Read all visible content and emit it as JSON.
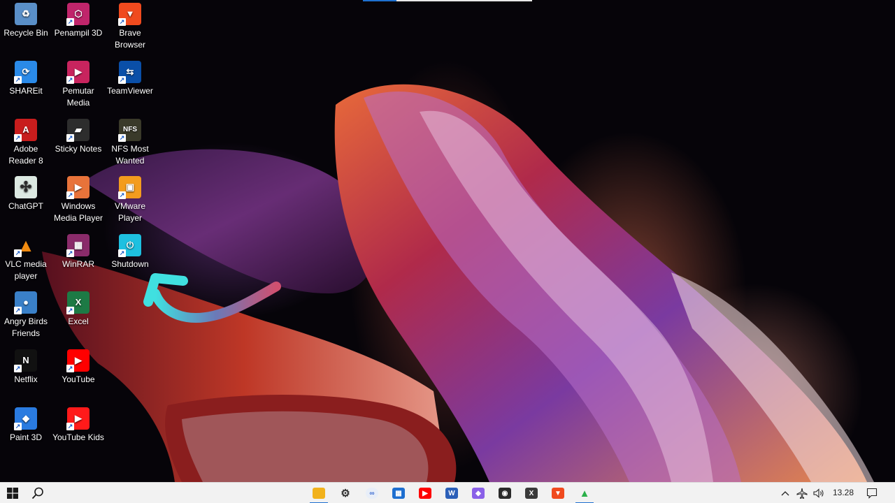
{
  "desktop": {
    "icons": [
      {
        "label": "Recycle Bin",
        "icon": "recycle-bin-icon",
        "color": "#5a8fc8",
        "glyph": "♻",
        "shortcut": false
      },
      {
        "label": "Penampil 3D",
        "icon": "3d-viewer-icon",
        "color": "#c0256b",
        "glyph": "⬡",
        "shortcut": true
      },
      {
        "label": "Brave Browser",
        "icon": "brave-icon",
        "color": "#f04a1e",
        "glyph": "▼",
        "shortcut": true
      },
      {
        "label": "SHAREit",
        "icon": "shareit-icon",
        "color": "#2a8ae8",
        "glyph": "⟳",
        "shortcut": true
      },
      {
        "label": "Pemutar Media",
        "icon": "media-player-icon",
        "color": "#c8245e",
        "glyph": "▶",
        "shortcut": true
      },
      {
        "label": "TeamViewer",
        "icon": "teamviewer-icon",
        "color": "#0a4fa8",
        "glyph": "⇆",
        "shortcut": true
      },
      {
        "label": "Adobe Reader 8",
        "icon": "adobe-reader-icon",
        "color": "#c81d1d",
        "glyph": "A",
        "shortcut": true
      },
      {
        "label": "Sticky Notes",
        "icon": "sticky-notes-icon",
        "color": "#2d2d2d",
        "glyph": "▰",
        "shortcut": true
      },
      {
        "label": "NFS Most Wanted",
        "icon": "nfs-icon",
        "color": "#3a3a2a",
        "glyph": "NFS",
        "shortcut": true
      },
      {
        "label": "ChatGPT",
        "icon": "chatgpt-icon",
        "color": "#dce9e2",
        "glyph": "✣",
        "shortcut": false
      },
      {
        "label": "Windows Media Player",
        "icon": "windows-media-player-icon",
        "color": "#e8733a",
        "glyph": "▶",
        "shortcut": true
      },
      {
        "label": "VMware Player",
        "icon": "vmware-icon",
        "color": "#f39c1e",
        "glyph": "▣",
        "shortcut": true
      },
      {
        "label": "VLC media player",
        "icon": "vlc-icon",
        "color": "transparent",
        "glyph": "▲",
        "shortcut": true
      },
      {
        "label": "WinRAR",
        "icon": "winrar-icon",
        "color": "#8a2b6a",
        "glyph": "▦",
        "shortcut": true
      },
      {
        "label": "Shutdown",
        "icon": "power-icon",
        "color": "#1ec0e0",
        "glyph": "⏻",
        "shortcut": true
      },
      {
        "label": "Angry Birds Friends",
        "icon": "angry-birds-icon",
        "color": "#3a80c8",
        "glyph": "●",
        "shortcut": true
      },
      {
        "label": "Excel",
        "icon": "excel-icon",
        "color": "#1d7a45",
        "glyph": "X",
        "shortcut": true
      },
      {
        "label": "Netflix",
        "icon": "netflix-icon",
        "color": "#111111",
        "glyph": "N",
        "shortcut": true
      },
      {
        "label": "YouTube",
        "icon": "youtube-icon",
        "color": "#ff0000",
        "glyph": "▶",
        "shortcut": true
      },
      {
        "label": "Paint 3D",
        "icon": "paint-3d-icon",
        "color": "#2a7be0",
        "glyph": "◆",
        "shortcut": true
      },
      {
        "label": "YouTube Kids",
        "icon": "youtube-kids-icon",
        "color": "#ff1a1a",
        "glyph": "▶",
        "shortcut": true
      }
    ]
  },
  "taskbar": {
    "start_icon": "windows-start-icon",
    "search_icon": "search-icon",
    "apps": [
      {
        "name": "file-explorer",
        "color": "#f2b21c",
        "glyph": "▬",
        "active": true
      },
      {
        "name": "settings",
        "color": "transparent",
        "glyph": "⚙",
        "active": false
      },
      {
        "name": "messenger",
        "color": "#e8eef8",
        "glyph": "∞",
        "active": false
      },
      {
        "name": "microsoft-store",
        "color": "#1e6fd0",
        "glyph": "▦",
        "active": false
      },
      {
        "name": "youtube",
        "color": "#ff0000",
        "glyph": "▶",
        "active": false
      },
      {
        "name": "word",
        "color": "#2b5fb8",
        "glyph": "W",
        "active": false
      },
      {
        "name": "paint-3d",
        "color": "#8a60e8",
        "glyph": "◆",
        "active": false
      },
      {
        "name": "obs",
        "color": "#2a2a2a",
        "glyph": "◉",
        "active": false
      },
      {
        "name": "terminal",
        "color": "#3a3a3a",
        "glyph": "X",
        "active": false
      },
      {
        "name": "brave",
        "color": "#f04a1e",
        "glyph": "▼",
        "active": false
      },
      {
        "name": "google-drive",
        "color": "transparent",
        "glyph": "▲",
        "active": true
      }
    ],
    "tray": {
      "chevron_icon": "chevron-up-icon",
      "network_icon": "airplane-mode-icon",
      "volume_icon": "volume-icon",
      "time": "13.28",
      "notification_icon": "notification-icon"
    }
  }
}
